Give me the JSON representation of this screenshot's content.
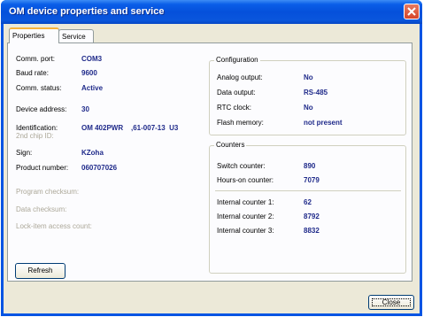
{
  "window": {
    "title": "OM device properties and service"
  },
  "tabs": {
    "properties": "Properties",
    "service": "Service"
  },
  "left": {
    "comm_port_label": "Comm. port:",
    "comm_port": "COM3",
    "baud_rate_label": "Baud rate:",
    "baud_rate": "9600",
    "comm_status_label": "Comm. status:",
    "comm_status": "Active",
    "device_address_label": "Device address:",
    "device_address": "30",
    "identification_label": "Identification:",
    "identification": "OM 402PWR    ,61-007-13  U3",
    "second_chip_label": "2nd chip ID:",
    "sign_label": "Sign:",
    "sign": "KZoha",
    "product_number_label": "Product number:",
    "product_number": "060707026",
    "program_checksum_label": "Program checksum:",
    "data_checksum_label": "Data checksum:",
    "lock_item_label": "Lock-item access count:"
  },
  "configuration": {
    "title": "Configuration",
    "analog_output_label": "Analog output:",
    "analog_output": "No",
    "data_output_label": "Data output:",
    "data_output": "RS-485",
    "rtc_clock_label": "RTC clock:",
    "rtc_clock": "No",
    "flash_memory_label": "Flash memory:",
    "flash_memory": "not present"
  },
  "counters": {
    "title": "Counters",
    "switch_counter_label": "Switch counter:",
    "switch_counter": "890",
    "hours_on_label": "Hours-on counter:",
    "hours_on": "7079",
    "internal1_label": "Internal counter 1:",
    "internal1": "62",
    "internal2_label": "Internal counter 2:",
    "internal2": "8792",
    "internal3_label": "Internal counter 3:",
    "internal3": "8832"
  },
  "buttons": {
    "refresh": "Refresh",
    "close": "Close"
  }
}
